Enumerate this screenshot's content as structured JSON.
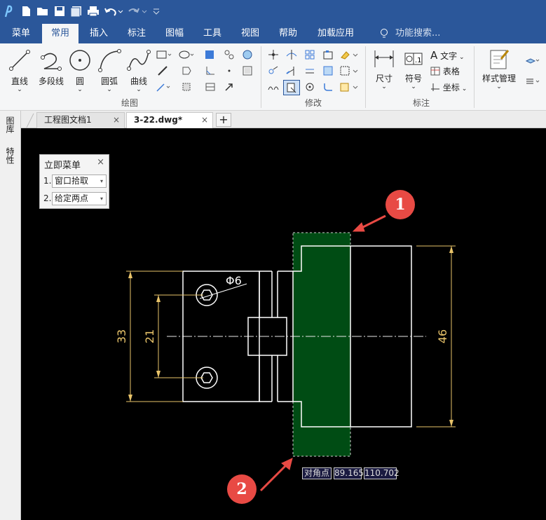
{
  "quick_access": [
    "app-logo-icon",
    "new-file-icon",
    "open-file-icon",
    "save-icon",
    "save-all-icon",
    "print-icon",
    "undo-icon",
    "redo-icon",
    "customize-icon"
  ],
  "menu": {
    "items": [
      "菜单",
      "常用",
      "插入",
      "标注",
      "图幅",
      "工具",
      "视图",
      "帮助",
      "加载应用"
    ],
    "active": "常用",
    "search_placeholder": "功能搜索..."
  },
  "ribbon": {
    "draw": {
      "buttons": [
        "直线",
        "多段线",
        "圆",
        "圆弧",
        "曲线"
      ],
      "group_label": "绘图"
    },
    "modify": {
      "group_label": "修改"
    },
    "annotate": {
      "buttons": [
        "尺寸",
        "符号"
      ],
      "small_buttons": [
        "文字",
        "表格",
        "坐标"
      ],
      "group_label": "标注"
    },
    "style": {
      "button": "样式管理"
    }
  },
  "doc_tabs": [
    {
      "label": "工程图文档1",
      "active": false
    },
    {
      "label": "3-22.dwg*",
      "active": true
    }
  ],
  "left_panel": [
    "图库",
    "特性"
  ],
  "immediate_menu": {
    "title": "立即菜单",
    "close": "×",
    "items": [
      {
        "index": "1.",
        "value": "窗口拾取"
      },
      {
        "index": "2.",
        "value": "给定两点"
      }
    ]
  },
  "drawing": {
    "dimensions": [
      "33",
      "21",
      "46"
    ],
    "diameter_label": "Φ6"
  },
  "coordinate_readout": {
    "label": "对角点",
    "x": "89.165",
    "y": "110.702"
  },
  "callouts": [
    "1",
    "2"
  ],
  "colors": {
    "title_bar": "#2b579a",
    "canvas": "#000000",
    "selection_fill": "#004c14",
    "dimension": "#e9c46a",
    "callout": "#e84a44"
  }
}
